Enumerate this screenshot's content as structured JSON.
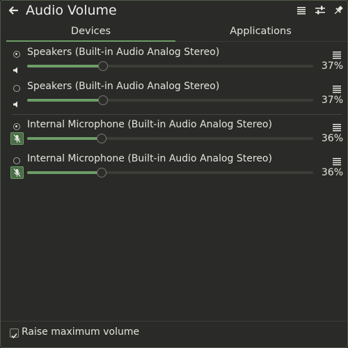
{
  "header": {
    "title": "Audio Volume"
  },
  "tabs": [
    {
      "label": "Devices",
      "active": true
    },
    {
      "label": "Applications",
      "active": false
    }
  ],
  "devices": [
    {
      "name": "Speakers (Built-in Audio Analog Stereo)",
      "selected": true,
      "kind": "output",
      "volume": 37,
      "volume_text": "37%"
    },
    {
      "name": "Speakers (Built-in Audio Analog Stereo)",
      "selected": false,
      "kind": "output",
      "volume": 37,
      "volume_text": "37%"
    },
    {
      "name": "Internal Microphone (Built-in Audio Analog Stereo)",
      "selected": true,
      "kind": "input",
      "volume": 36,
      "volume_text": "36%"
    },
    {
      "name": "Internal Microphone (Built-in Audio Analog Stereo)",
      "selected": false,
      "kind": "input",
      "volume": 36,
      "volume_text": "36%"
    }
  ],
  "footer": {
    "raise_max_label": "Raise maximum volume",
    "raise_max_checked": true
  },
  "colors": {
    "accent": "#6d9e67",
    "background": "#2a2a28",
    "text": "#e4e4de"
  },
  "icons": {
    "back": "arrow-left-icon",
    "menu": "hamburger-menu-icon",
    "settings": "sliders-icon",
    "pin": "pin-icon",
    "speaker": "speaker-icon",
    "microphone_muted": "microphone-muted-icon"
  }
}
